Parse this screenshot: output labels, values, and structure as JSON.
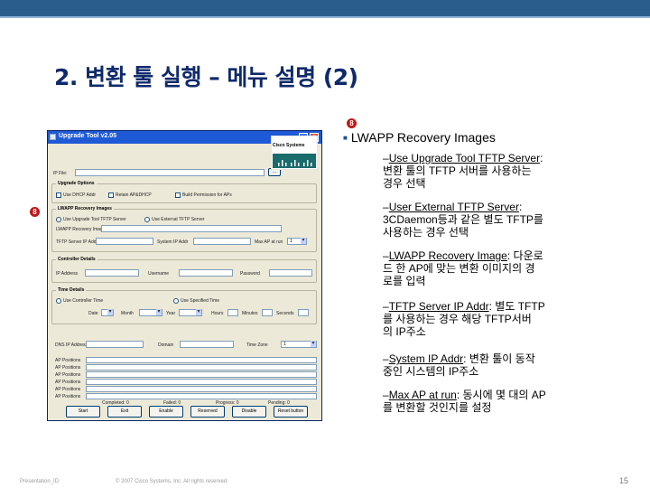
{
  "slide": {
    "title": "2. 변환 툴 실행 – 메뉴 설명 (2)",
    "footer_left": "Presentation_ID",
    "footer_mid": "© 2007 Cisco Systems, Inc. All rights reserved.",
    "page_number": "15",
    "marker_label": "8",
    "brand_color": "#2a5d8c",
    "title_color": "#0f2a6b"
  },
  "window": {
    "title": "Upgrade Tool v2.05",
    "logo_text": "Cisco Systems",
    "file_label": "IP File:",
    "upgrade_options": {
      "label": "Upgrade Options",
      "opt1": "Use DHCP Addr",
      "opt2": "Retain AP&DHCP",
      "opt3": "Build Permission for APs"
    },
    "lwapp": {
      "label": "LWAPP Recovery Images",
      "radio1": "Use Upgrade Tool TFTP Server",
      "radio2": "Use External TFTP Server",
      "image_label": "LWAPP Recovery Image",
      "tftp_label": "TFTP Server IP Addr",
      "system_label": "System IP Addr",
      "max_label": "Max AP at run",
      "max_value": "1"
    },
    "controller": {
      "label": "Controller Details",
      "ip": "IP Address",
      "user": "Username",
      "pass": "Password"
    },
    "time": {
      "label": "Time Details",
      "radio1": "Use Controller Time",
      "radio2": "Use Specified Time",
      "date": "Date",
      "month": "Month",
      "year": "Year",
      "hour": "Hours",
      "min": "Minutes",
      "sec": "Seconds"
    },
    "dns": {
      "ip": "DNS IP Address",
      "domain": "Domain",
      "timezone": "Time Zone",
      "timezone_value": "1"
    },
    "ap_labels": [
      "AP Positions",
      "AP Positions",
      "AP Positions",
      "AP Positions",
      "AP Positions",
      "AP Positions"
    ],
    "status": {
      "complete": "Completed: 0",
      "failed": "Failed: 0",
      "progress": "Progress: 0",
      "pending": "Pending: 0"
    },
    "buttons": [
      "Start",
      "Exit",
      "Enable",
      "Reserved",
      "Disable",
      "Reset button"
    ]
  },
  "notes": {
    "heading": "LWAPP Recovery Images",
    "items": [
      {
        "underline": "Use Upgrade Tool TFTP Server",
        "rest_1": ":",
        "rest_2": "변환 툴의 TFTP 서버를 사용하는",
        "rest_3": "경우 선택"
      },
      {
        "underline": "User External TFTP Server",
        "rest_1": ":",
        "rest_2": "3CDaemon등과 같은 별도 TFTP를",
        "rest_3": "사용하는 경우 선택"
      },
      {
        "underline": "LWAPP Recovery Image",
        "rest_1": ": 다운로",
        "rest_2": "드 한 AP에 맞는 변환 이미지의 경",
        "rest_3": "로를 입력"
      },
      {
        "underline": "TFTP Server IP Addr",
        "rest_1": ": 별도 TFTP",
        "rest_2": "를 사용하는 경우 해당 TFTP서버",
        "rest_3": "의 IP주소"
      },
      {
        "underline": "System IP Addr",
        "rest_1": ": 변환 툴이 동작",
        "rest_2": "중인 시스템의 IP주소",
        "rest_3": ""
      },
      {
        "underline": "Max AP at run",
        "rest_1": ": 동시에 몇 대의 AP",
        "rest_2": "를 변환할 것인지를 설정",
        "rest_3": ""
      }
    ]
  }
}
